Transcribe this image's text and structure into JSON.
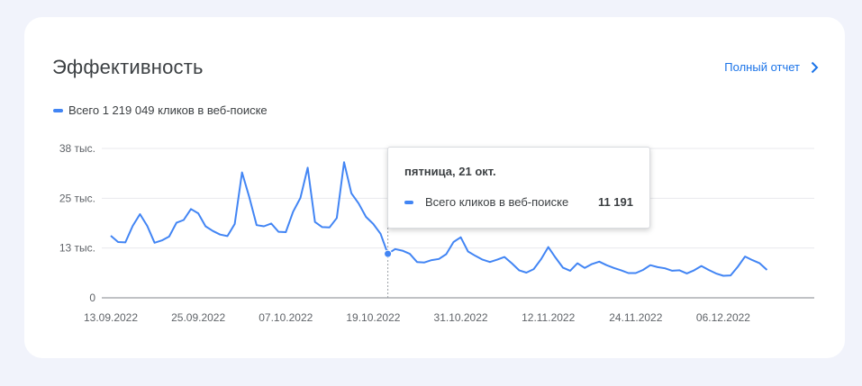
{
  "card": {
    "title": "Эффективность",
    "full_report_label": "Полный отчет",
    "legend_label": "Всего 1 219 049 кликов в веб-поиске"
  },
  "tooltip": {
    "date": "пятница, 21 окт.",
    "series_label": "Всего кликов в веб-поиске",
    "value": "11 191"
  },
  "colors": {
    "accent": "#1a73e8",
    "series": "#4285f4",
    "background": "#f1f3fb"
  },
  "chart_data": {
    "type": "line",
    "series_name": "Всего кликов в веб-поиске",
    "x_start": "2022-09-13",
    "x_end": "2022-12-17",
    "xticks": [
      "13.09.2022",
      "25.09.2022",
      "07.10.2022",
      "19.10.2022",
      "31.10.2022",
      "12.11.2022",
      "24.11.2022",
      "06.12.2022"
    ],
    "yticks": [
      "0",
      "13 тыс.",
      "25 тыс.",
      "38 тыс."
    ],
    "ylim": [
      0,
      38000
    ],
    "grid": true,
    "highlight_date": "2022-10-21",
    "values": [
      15800,
      14200,
      14100,
      18300,
      21300,
      18300,
      14000,
      14600,
      15600,
      19100,
      19800,
      22600,
      21500,
      18200,
      17000,
      16100,
      15700,
      18800,
      31900,
      25600,
      18500,
      18200,
      18900,
      16800,
      16700,
      21900,
      25400,
      33100,
      19300,
      18000,
      17900,
      20300,
      34500,
      26600,
      24000,
      20600,
      18800,
      16300,
      11191,
      12400,
      12000,
      11200,
      9100,
      9000,
      9600,
      9900,
      11100,
      14200,
      15400,
      11800,
      10700,
      9700,
      9100,
      9700,
      10400,
      8800,
      7000,
      6400,
      7300,
      9800,
      12900,
      10200,
      7700,
      6900,
      8800,
      7600,
      8600,
      9200,
      8300,
      7600,
      7000,
      6300,
      6300,
      7100,
      8300,
      7800,
      7500,
      6900,
      7000,
      6200,
      7000,
      8100,
      7100,
      6200,
      5600,
      5700,
      7900,
      10500,
      9600,
      8800,
      7100
    ]
  }
}
